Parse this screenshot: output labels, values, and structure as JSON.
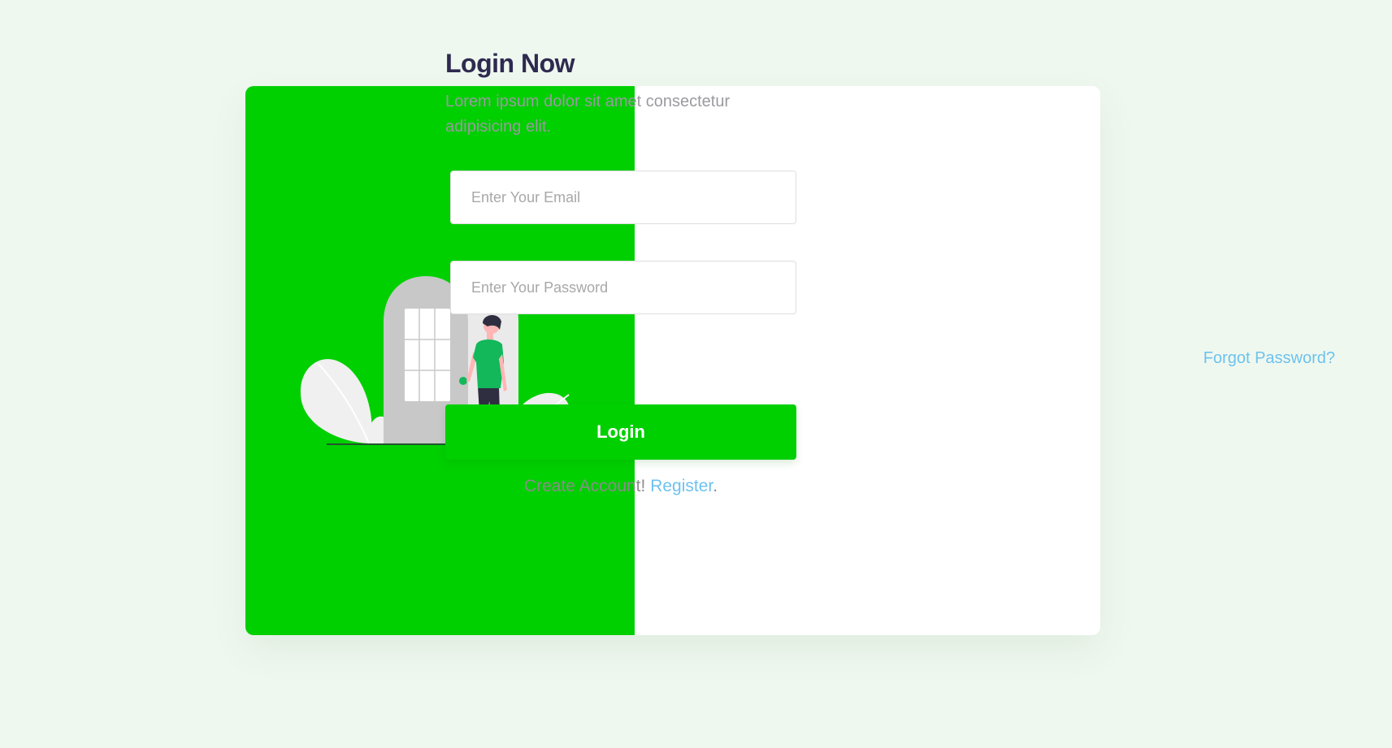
{
  "colors": {
    "page_background": "#eff8ef",
    "accent": "#00cf00",
    "link": "#6ec2ee",
    "title": "#2e2a4f",
    "muted_text": "#9a9aa0"
  },
  "login": {
    "title": "Login Now",
    "subtitle": "Lorem ipsum dolor sit amet consectetur adipisicing elit.",
    "email_placeholder": "Enter Your Email",
    "password_placeholder": "Enter Your Password",
    "forgot_password": "Forgot Password?",
    "submit_label": "Login",
    "create_account_prefix": "Create Account!",
    "register_link": "Register",
    "create_account_suffix": "."
  },
  "illustration": {
    "icon": "person-at-door-illustration"
  }
}
